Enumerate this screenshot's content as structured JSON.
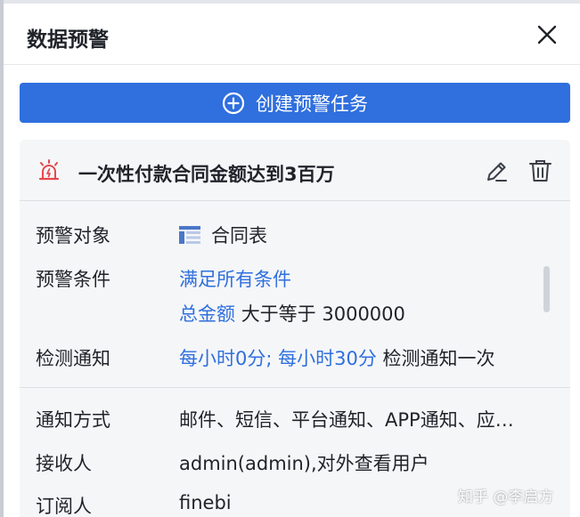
{
  "header": {
    "title": "数据预警",
    "close_icon": "close-icon"
  },
  "create_button": {
    "label": "创建预警任务",
    "icon": "plus-circle-icon",
    "color": "#2f6fde"
  },
  "task": {
    "name": "一次性付款合同金额达到3百万",
    "alarm_icon": "alarm-icon",
    "alarm_color": "#e5484d",
    "target": {
      "label": "预警对象",
      "icon": "table-icon",
      "value": "合同表"
    },
    "condition": {
      "label": "预警条件",
      "rule": "满足所有条件",
      "field": "总金额",
      "operator_value": "大于等于 3000000"
    },
    "check": {
      "label": "检测通知",
      "schedule": "每小时0分; 每小时30分",
      "suffix": "检测通知一次"
    },
    "notify_method": {
      "label": "通知方式",
      "value": "邮件、短信、平台通知、APP通知、应…"
    },
    "receivers": {
      "label": "接收人",
      "value": "admin(admin),对外查看用户"
    },
    "subscribers": {
      "label": "订阅人",
      "value": "finebi"
    }
  },
  "watermark": "知乎 @李启方"
}
